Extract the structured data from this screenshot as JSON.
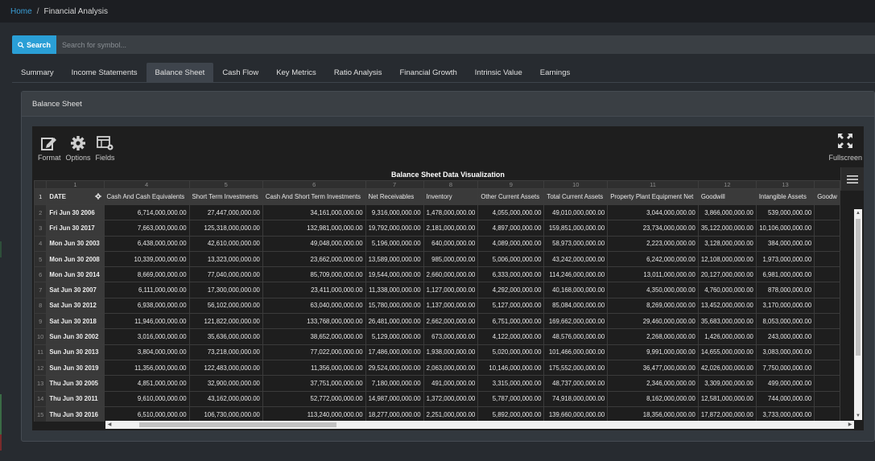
{
  "breadcrumb": {
    "home": "Home",
    "separator": "/",
    "current": "Financial Analysis"
  },
  "search": {
    "button_label": "Search",
    "placeholder": "Search for symbol..."
  },
  "tabs": [
    {
      "label": "Summary",
      "active": false
    },
    {
      "label": "Income Statements",
      "active": false
    },
    {
      "label": "Balance Sheet",
      "active": true
    },
    {
      "label": "Cash Flow",
      "active": false
    },
    {
      "label": "Key Metrics",
      "active": false
    },
    {
      "label": "Ratio Analysis",
      "active": false
    },
    {
      "label": "Financial Growth",
      "active": false
    },
    {
      "label": "Intrinsic Value",
      "active": false
    },
    {
      "label": "Earnings",
      "active": false
    }
  ],
  "panel": {
    "title": "Balance Sheet"
  },
  "toolbar": {
    "format_label": "Format",
    "options_label": "Options",
    "fields_label": "Fields",
    "fullscreen_label": "Fullscreen"
  },
  "pivot": {
    "title": "Balance Sheet Data Visualization",
    "column_numbers": [
      "1",
      "4",
      "5",
      "6",
      "7",
      "8",
      "9",
      "10",
      "11",
      "12",
      "13",
      ""
    ],
    "date_header": "DATE",
    "columns": [
      "Cash And Cash Equivalents",
      "Short Term Investments",
      "Cash And Short Term Investments",
      "Net Receivables",
      "Inventory",
      "Other Current Assets",
      "Total Current Assets",
      "Property Plant Equipment Net",
      "Goodwill",
      "Intangible Assets",
      "Goodw"
    ],
    "rows": [
      {
        "n": "2",
        "date": "Fri Jun 30 2006",
        "values": [
          "6,714,000,000.00",
          "27,447,000,000.00",
          "34,161,000,000.00",
          "9,316,000,000.00",
          "1,478,000,000.00",
          "4,055,000,000.00",
          "49,010,000,000.00",
          "3,044,000,000.00",
          "3,866,000,000.00",
          "539,000,000.00",
          ""
        ]
      },
      {
        "n": "3",
        "date": "Fri Jun 30 2017",
        "values": [
          "7,663,000,000.00",
          "125,318,000,000.00",
          "132,981,000,000.00",
          "19,792,000,000.00",
          "2,181,000,000.00",
          "4,897,000,000.00",
          "159,851,000,000.00",
          "23,734,000,000.00",
          "35,122,000,000.00",
          "10,106,000,000.00",
          ""
        ]
      },
      {
        "n": "4",
        "date": "Mon Jun 30 2003",
        "values": [
          "6,438,000,000.00",
          "42,610,000,000.00",
          "49,048,000,000.00",
          "5,196,000,000.00",
          "640,000,000.00",
          "4,089,000,000.00",
          "58,973,000,000.00",
          "2,223,000,000.00",
          "3,128,000,000.00",
          "384,000,000.00",
          ""
        ]
      },
      {
        "n": "5",
        "date": "Mon Jun 30 2008",
        "values": [
          "10,339,000,000.00",
          "13,323,000,000.00",
          "23,662,000,000.00",
          "13,589,000,000.00",
          "985,000,000.00",
          "5,006,000,000.00",
          "43,242,000,000.00",
          "6,242,000,000.00",
          "12,108,000,000.00",
          "1,973,000,000.00",
          ""
        ]
      },
      {
        "n": "6",
        "date": "Mon Jun 30 2014",
        "values": [
          "8,669,000,000.00",
          "77,040,000,000.00",
          "85,709,000,000.00",
          "19,544,000,000.00",
          "2,660,000,000.00",
          "6,333,000,000.00",
          "114,246,000,000.00",
          "13,011,000,000.00",
          "20,127,000,000.00",
          "6,981,000,000.00",
          ""
        ]
      },
      {
        "n": "7",
        "date": "Sat Jun 30 2007",
        "values": [
          "6,111,000,000.00",
          "17,300,000,000.00",
          "23,411,000,000.00",
          "11,338,000,000.00",
          "1,127,000,000.00",
          "4,292,000,000.00",
          "40,168,000,000.00",
          "4,350,000,000.00",
          "4,760,000,000.00",
          "878,000,000.00",
          ""
        ]
      },
      {
        "n": "8",
        "date": "Sat Jun 30 2012",
        "values": [
          "6,938,000,000.00",
          "56,102,000,000.00",
          "63,040,000,000.00",
          "15,780,000,000.00",
          "1,137,000,000.00",
          "5,127,000,000.00",
          "85,084,000,000.00",
          "8,269,000,000.00",
          "13,452,000,000.00",
          "3,170,000,000.00",
          ""
        ]
      },
      {
        "n": "9",
        "date": "Sat Jun 30 2018",
        "values": [
          "11,946,000,000.00",
          "121,822,000,000.00",
          "133,768,000,000.00",
          "26,481,000,000.00",
          "2,662,000,000.00",
          "6,751,000,000.00",
          "169,662,000,000.00",
          "29,460,000,000.00",
          "35,683,000,000.00",
          "8,053,000,000.00",
          ""
        ]
      },
      {
        "n": "10",
        "date": "Sun Jun 30 2002",
        "values": [
          "3,016,000,000.00",
          "35,636,000,000.00",
          "38,652,000,000.00",
          "5,129,000,000.00",
          "673,000,000.00",
          "4,122,000,000.00",
          "48,576,000,000.00",
          "2,268,000,000.00",
          "1,426,000,000.00",
          "243,000,000.00",
          ""
        ]
      },
      {
        "n": "11",
        "date": "Sun Jun 30 2013",
        "values": [
          "3,804,000,000.00",
          "73,218,000,000.00",
          "77,022,000,000.00",
          "17,486,000,000.00",
          "1,938,000,000.00",
          "5,020,000,000.00",
          "101,466,000,000.00",
          "9,991,000,000.00",
          "14,655,000,000.00",
          "3,083,000,000.00",
          ""
        ]
      },
      {
        "n": "12",
        "date": "Sun Jun 30 2019",
        "values": [
          "11,356,000,000.00",
          "122,483,000,000.00",
          "11,356,000,000.00",
          "29,524,000,000.00",
          "2,063,000,000.00",
          "10,146,000,000.00",
          "175,552,000,000.00",
          "36,477,000,000.00",
          "42,026,000,000.00",
          "7,750,000,000.00",
          ""
        ]
      },
      {
        "n": "13",
        "date": "Thu Jun 30 2005",
        "values": [
          "4,851,000,000.00",
          "32,900,000,000.00",
          "37,751,000,000.00",
          "7,180,000,000.00",
          "491,000,000.00",
          "3,315,000,000.00",
          "48,737,000,000.00",
          "2,346,000,000.00",
          "3,309,000,000.00",
          "499,000,000.00",
          ""
        ]
      },
      {
        "n": "14",
        "date": "Thu Jun 30 2011",
        "values": [
          "9,610,000,000.00",
          "43,162,000,000.00",
          "52,772,000,000.00",
          "14,987,000,000.00",
          "1,372,000,000.00",
          "5,787,000,000.00",
          "74,918,000,000.00",
          "8,162,000,000.00",
          "12,581,000,000.00",
          "744,000,000.00",
          ""
        ]
      },
      {
        "n": "15",
        "date": "Thu Jun 30 2016",
        "values": [
          "6,510,000,000.00",
          "106,730,000,000.00",
          "113,240,000,000.00",
          "18,277,000,000.00",
          "2,251,000,000.00",
          "5,892,000,000.00",
          "139,660,000,000.00",
          "18,356,000,000.00",
          "17,872,000,000.00",
          "3,733,000,000.00",
          ""
        ]
      }
    ]
  }
}
